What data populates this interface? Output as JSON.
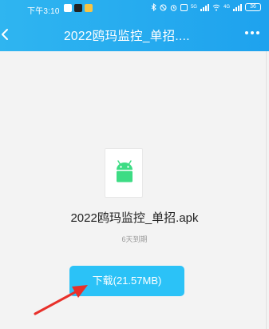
{
  "status_bar": {
    "time": "下午3:10",
    "signal_1_tag": "5G",
    "signal_2_tag": "4G",
    "battery": "36"
  },
  "header": {
    "title": "2022鸥玛监控_单招....",
    "background_color": "#1ea2ee"
  },
  "file": {
    "icon": "android-icon",
    "icon_color": "#3ddc84",
    "name": "2022鸥玛监控_单招.apk",
    "expire_text": "6天到期"
  },
  "actions": {
    "download_label": "下载(21.57MB)",
    "download_color": "#2bc2f7"
  },
  "annotation": {
    "arrow_color": "#e8302a"
  }
}
